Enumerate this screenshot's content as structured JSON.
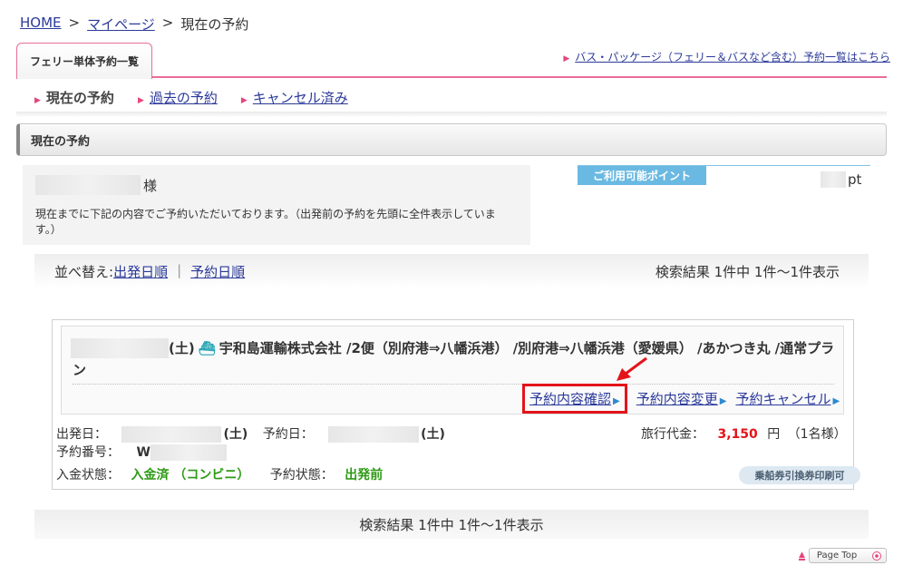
{
  "breadcrumb": {
    "home": "HOME",
    "sep1": ">",
    "mypage": "マイページ",
    "sep2": ">",
    "current": "現在の予約"
  },
  "tabs": {
    "ferry": "フェリー単体予約一覧",
    "bus_link": "バス・パッケージ（フェリー＆バスなど含む）予約一覧はこちら"
  },
  "subnav": {
    "current": "現在の予約",
    "past": "過去の予約",
    "cancelled": "キャンセル済み"
  },
  "section": {
    "title": "現在の予約"
  },
  "greeting": {
    "suffix": "様",
    "message": "現在までに下記の内容でご予約いただいております。（出発前の予約を先頭に全件表示しています。）"
  },
  "points": {
    "label": "ご利用可能ポイント",
    "unit": "pt"
  },
  "sort": {
    "label": "並べ替え:",
    "by_departure": "出発日順",
    "divider": "|",
    "by_booking": "予約日順"
  },
  "results": {
    "summary": "検索結果 1件中 1件〜1件表示"
  },
  "reservation": {
    "day": "(土)",
    "title": "宇和島運輸株式会社 /2便（別府港⇒八幡浜港） /別府港⇒八幡浜港（愛媛県） /あかつき丸 /通常プラン",
    "actions": {
      "confirm": "予約内容確認",
      "change": "予約内容変更",
      "cancel": "予約キャンセル"
    },
    "departure_label": "出発日：",
    "departure_day": "(土)",
    "booking_label": "予約日：",
    "booking_day": "(土)",
    "number_label": "予約番号：",
    "number_prefix": "W",
    "fare_label": "旅行代金：",
    "fare_value": "3,150",
    "fare_unit": "円",
    "fare_people": "（1名様）",
    "payment_label": "入金状態：",
    "payment_value": "入金済 （コンビニ）",
    "status_label": "予約状態：",
    "status_value": "出発前",
    "badge": "乗船券引換券印刷可"
  },
  "pagetop": {
    "label": "Page Top"
  },
  "icons": {
    "list_marker": "triangle-right-icon",
    "ship": "ship-icon",
    "annotation": "red-arrow-icon",
    "pagetop": "up-arrow-icon"
  },
  "colors": {
    "accent_pink": "#e86d9a",
    "link": "#2b3a9a",
    "green": "#2e9a15",
    "price_red": "#e3141a",
    "points_blue": "#6ab9e2"
  }
}
